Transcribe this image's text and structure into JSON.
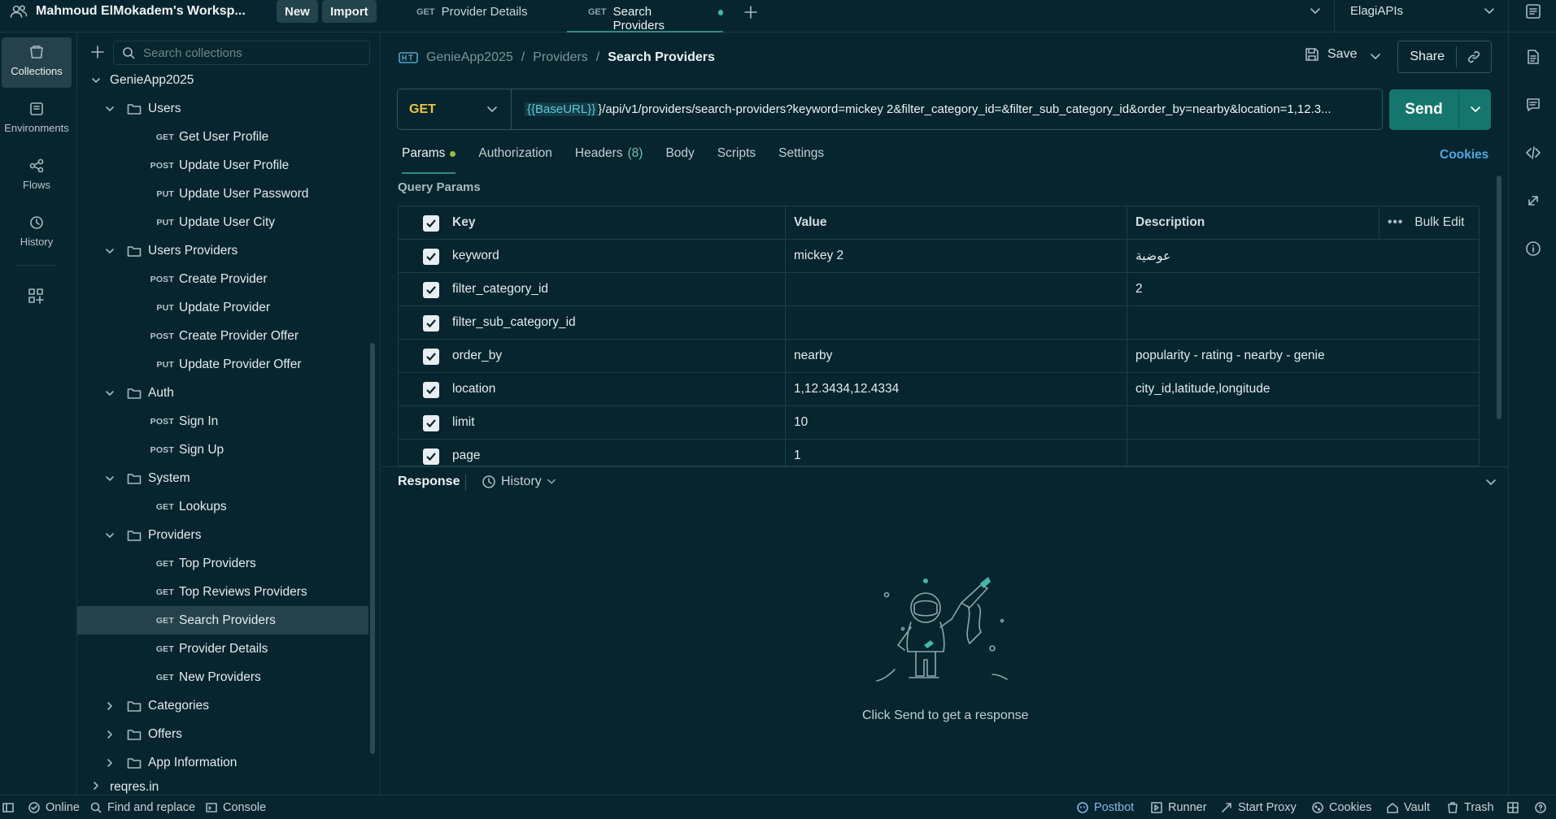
{
  "topbar": {
    "workspace": "Mahmoud ElMokadem's Worksp...",
    "new_label": "New",
    "import_label": "Import",
    "tabs": [
      {
        "method": "GET",
        "label": "Provider Details"
      },
      {
        "method": "GET",
        "label": "Search Providers"
      }
    ],
    "environment": "ElagiAPIs"
  },
  "rail": {
    "items": [
      "Collections",
      "Environments",
      "Flows",
      "History"
    ]
  },
  "sidebar": {
    "search_placeholder": "Search collections",
    "collection": "GenieApp2025",
    "folders": {
      "users": "Users",
      "users_providers": "Users Providers",
      "auth": "Auth",
      "system": "System",
      "providers": "Providers",
      "categories": "Categories",
      "offers": "Offers",
      "app_information": "App Information"
    },
    "requests": [
      {
        "method": "GET",
        "label": "Get User Profile"
      },
      {
        "method": "POST",
        "label": "Update User Profile"
      },
      {
        "method": "PUT",
        "label": "Update User Password"
      },
      {
        "method": "PUT",
        "label": "Update User City"
      },
      {
        "method": "POST",
        "label": "Create Provider"
      },
      {
        "method": "PUT",
        "label": "Update Provider"
      },
      {
        "method": "POST",
        "label": "Create Provider Offer"
      },
      {
        "method": "PUT",
        "label": "Update Provider Offer"
      },
      {
        "method": "POST",
        "label": "Sign In"
      },
      {
        "method": "POST",
        "label": "Sign Up"
      },
      {
        "method": "GET",
        "label": "Lookups"
      },
      {
        "method": "GET",
        "label": "Top Providers"
      },
      {
        "method": "GET",
        "label": "Top Reviews Providers"
      },
      {
        "method": "GET",
        "label": "Search Providers"
      },
      {
        "method": "GET",
        "label": "Provider Details"
      },
      {
        "method": "GET",
        "label": "New Providers"
      }
    ],
    "other_collection": "reqres.in"
  },
  "main": {
    "breadcrumb": [
      "GenieApp2025",
      "Providers",
      "Search Providers"
    ],
    "save_label": "Save",
    "share_label": "Share",
    "method": "GET",
    "url_var": "{{BaseURL}}",
    "url_rest": "}/api/v1/providers/search-providers?keyword=mickey 2&filter_category_id=&filter_sub_category_id&order_by=nearby&location=1,12.3...",
    "send_label": "Send",
    "tabs": [
      {
        "label": "Params"
      },
      {
        "label": "Authorization"
      },
      {
        "label": "Headers",
        "count": "(8)"
      },
      {
        "label": "Body"
      },
      {
        "label": "Scripts"
      },
      {
        "label": "Settings"
      }
    ],
    "cookies_label": "Cookies",
    "query_params_title": "Query Params",
    "columns": {
      "key": "Key",
      "value": "Value",
      "description": "Description",
      "bulk_edit": "Bulk Edit"
    },
    "params": [
      {
        "key": "keyword",
        "value": "mickey 2",
        "description": "عوضية"
      },
      {
        "key": "filter_category_id",
        "value": "",
        "description": "2"
      },
      {
        "key": "filter_sub_category_id",
        "value": "",
        "description": ""
      },
      {
        "key": "order_by",
        "value": "nearby",
        "description": "popularity - rating - nearby - genie"
      },
      {
        "key": "location",
        "value": "1,12.3434,12.4334",
        "description": "city_id,latitude,longitude"
      },
      {
        "key": "limit",
        "value": "10",
        "description": ""
      },
      {
        "key": "page",
        "value": "1",
        "description": ""
      }
    ],
    "response_title": "Response",
    "history_label": "History",
    "empty_message": "Click Send to get a response"
  },
  "statusbar": {
    "online": "Online",
    "find_replace": "Find and replace",
    "console": "Console",
    "postbot": "Postbot",
    "runner": "Runner",
    "start_proxy": "Start Proxy",
    "cookies": "Cookies",
    "vault": "Vault",
    "trash": "Trash"
  },
  "colors": {
    "background": "#06252f",
    "accent": "#14766d",
    "get_method": "#f0c63f",
    "link": "#4fa8e0"
  }
}
